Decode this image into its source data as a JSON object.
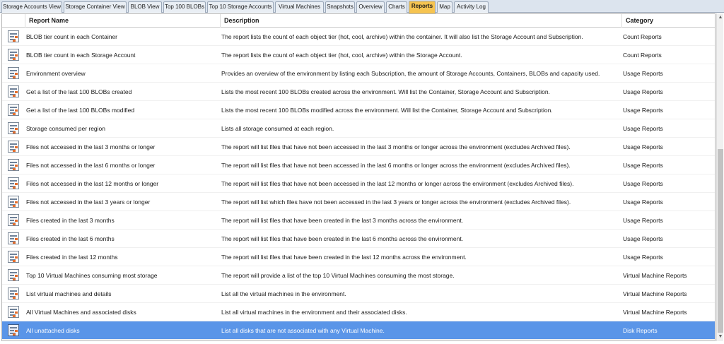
{
  "tabs": [
    {
      "label": "Storage Accounts View",
      "active": false
    },
    {
      "label": "Storage Container View",
      "active": false
    },
    {
      "label": "BLOB View",
      "active": false
    },
    {
      "label": "Top 100 BLOBs",
      "active": false
    },
    {
      "label": "Top 10 Storage Accounts",
      "active": false
    },
    {
      "label": "Virtual Machines",
      "active": false
    },
    {
      "label": "Snapshots",
      "active": false
    },
    {
      "label": "Overview",
      "active": false
    },
    {
      "label": "Charts",
      "active": false
    },
    {
      "label": "Reports",
      "active": true
    },
    {
      "label": "Map",
      "active": false
    },
    {
      "label": "Activity Log",
      "active": false
    }
  ],
  "table": {
    "columns": {
      "name": "Report Name",
      "description": "Description",
      "category": "Category"
    },
    "rows": [
      {
        "name": "BLOB tier count in each Container",
        "description": "The report lists the count of each object tier (hot, cool, archive) within the container. It will also list the Storage Account and Subscription.",
        "category": "Count Reports"
      },
      {
        "name": "BLOB tier count in each Storage Account",
        "description": "The report lists the count of each object tier (hot, cool, archive) within the Storage Account.",
        "category": "Count Reports"
      },
      {
        "name": "Environment overview",
        "description": "Provides an overview of the environment by listing each Subscription, the amount of Storage Accounts, Containers, BLOBs and capacity used.",
        "category": "Usage Reports"
      },
      {
        "name": "Get a list of the last 100 BLOBs created",
        "description": "Lists the most recent 100 BLOBs created across the environment. Will list the Container, Storage Account and Subscription.",
        "category": "Usage Reports"
      },
      {
        "name": "Get a list of the last 100 BLOBs modified",
        "description": "Lists the most recent 100 BLOBs modified across the environment. Will list the Container, Storage Account and Subscription.",
        "category": "Usage Reports"
      },
      {
        "name": "Storage consumed per region",
        "description": "Lists all storage consumed at each region.",
        "category": "Usage Reports"
      },
      {
        "name": "Files not accessed in the last 3 months or longer",
        "description": "The report will list files that have not been accessed in the last 3 months or longer across the environment (excludes Archived files).",
        "category": "Usage Reports"
      },
      {
        "name": "Files not accessed in the last 6 months or longer",
        "description": "The report will list files that have not been accessed in the last 6 months or longer across the environment (excludes Archived files).",
        "category": "Usage Reports"
      },
      {
        "name": "Files not accessed in the last 12 months or longer",
        "description": "The report will list files that have not been accessed in the last 12 months or longer across the environment (excludes Archived files).",
        "category": "Usage Reports"
      },
      {
        "name": "Files not accessed in the last 3 years or longer",
        "description": "The report will list which files have not been accessed in the last 3 years or longer across the environment (excludes Archived files).",
        "category": "Usage Reports"
      },
      {
        "name": "Files created in the last 3 months",
        "description": "The report will list files that have been created in the last 3 months across the environment.",
        "category": "Usage Reports"
      },
      {
        "name": "Files created in the last 6 months",
        "description": "The report will list files that have been created in the last 6 months across the environment.",
        "category": "Usage Reports"
      },
      {
        "name": "Files created in the last 12 months",
        "description": "The report will list files that have been created in the last 12 months across the environment.",
        "category": "Usage Reports"
      },
      {
        "name": "Top 10 Virtual Machines consuming most storage",
        "description": "The report will provide a list of the top 10 Virtual Machines consuming the most storage.",
        "category": "Virtual Machine Reports"
      },
      {
        "name": "List virtual machines and details",
        "description": "List all the virtual machines in the environment.",
        "category": "Virtual Machine Reports"
      },
      {
        "name": "All Virtual Machines and associated disks",
        "description": "List all virtual machines in the environment and their associated disks.",
        "category": "Virtual Machine Reports"
      },
      {
        "name": "All unattached disks",
        "description": "List all disks that are not associated with any Virtual Machine.",
        "category": "Disk Reports",
        "selected": true
      }
    ]
  },
  "icons": {
    "row_icon": "report-icon",
    "scroll_up": "scroll-up-arrow-icon",
    "scroll_down": "scroll-down-arrow-icon"
  },
  "colors": {
    "active_tab": "#f6c451",
    "selected_row": "#5a95e8",
    "icon_accent": "#e36c2b"
  }
}
